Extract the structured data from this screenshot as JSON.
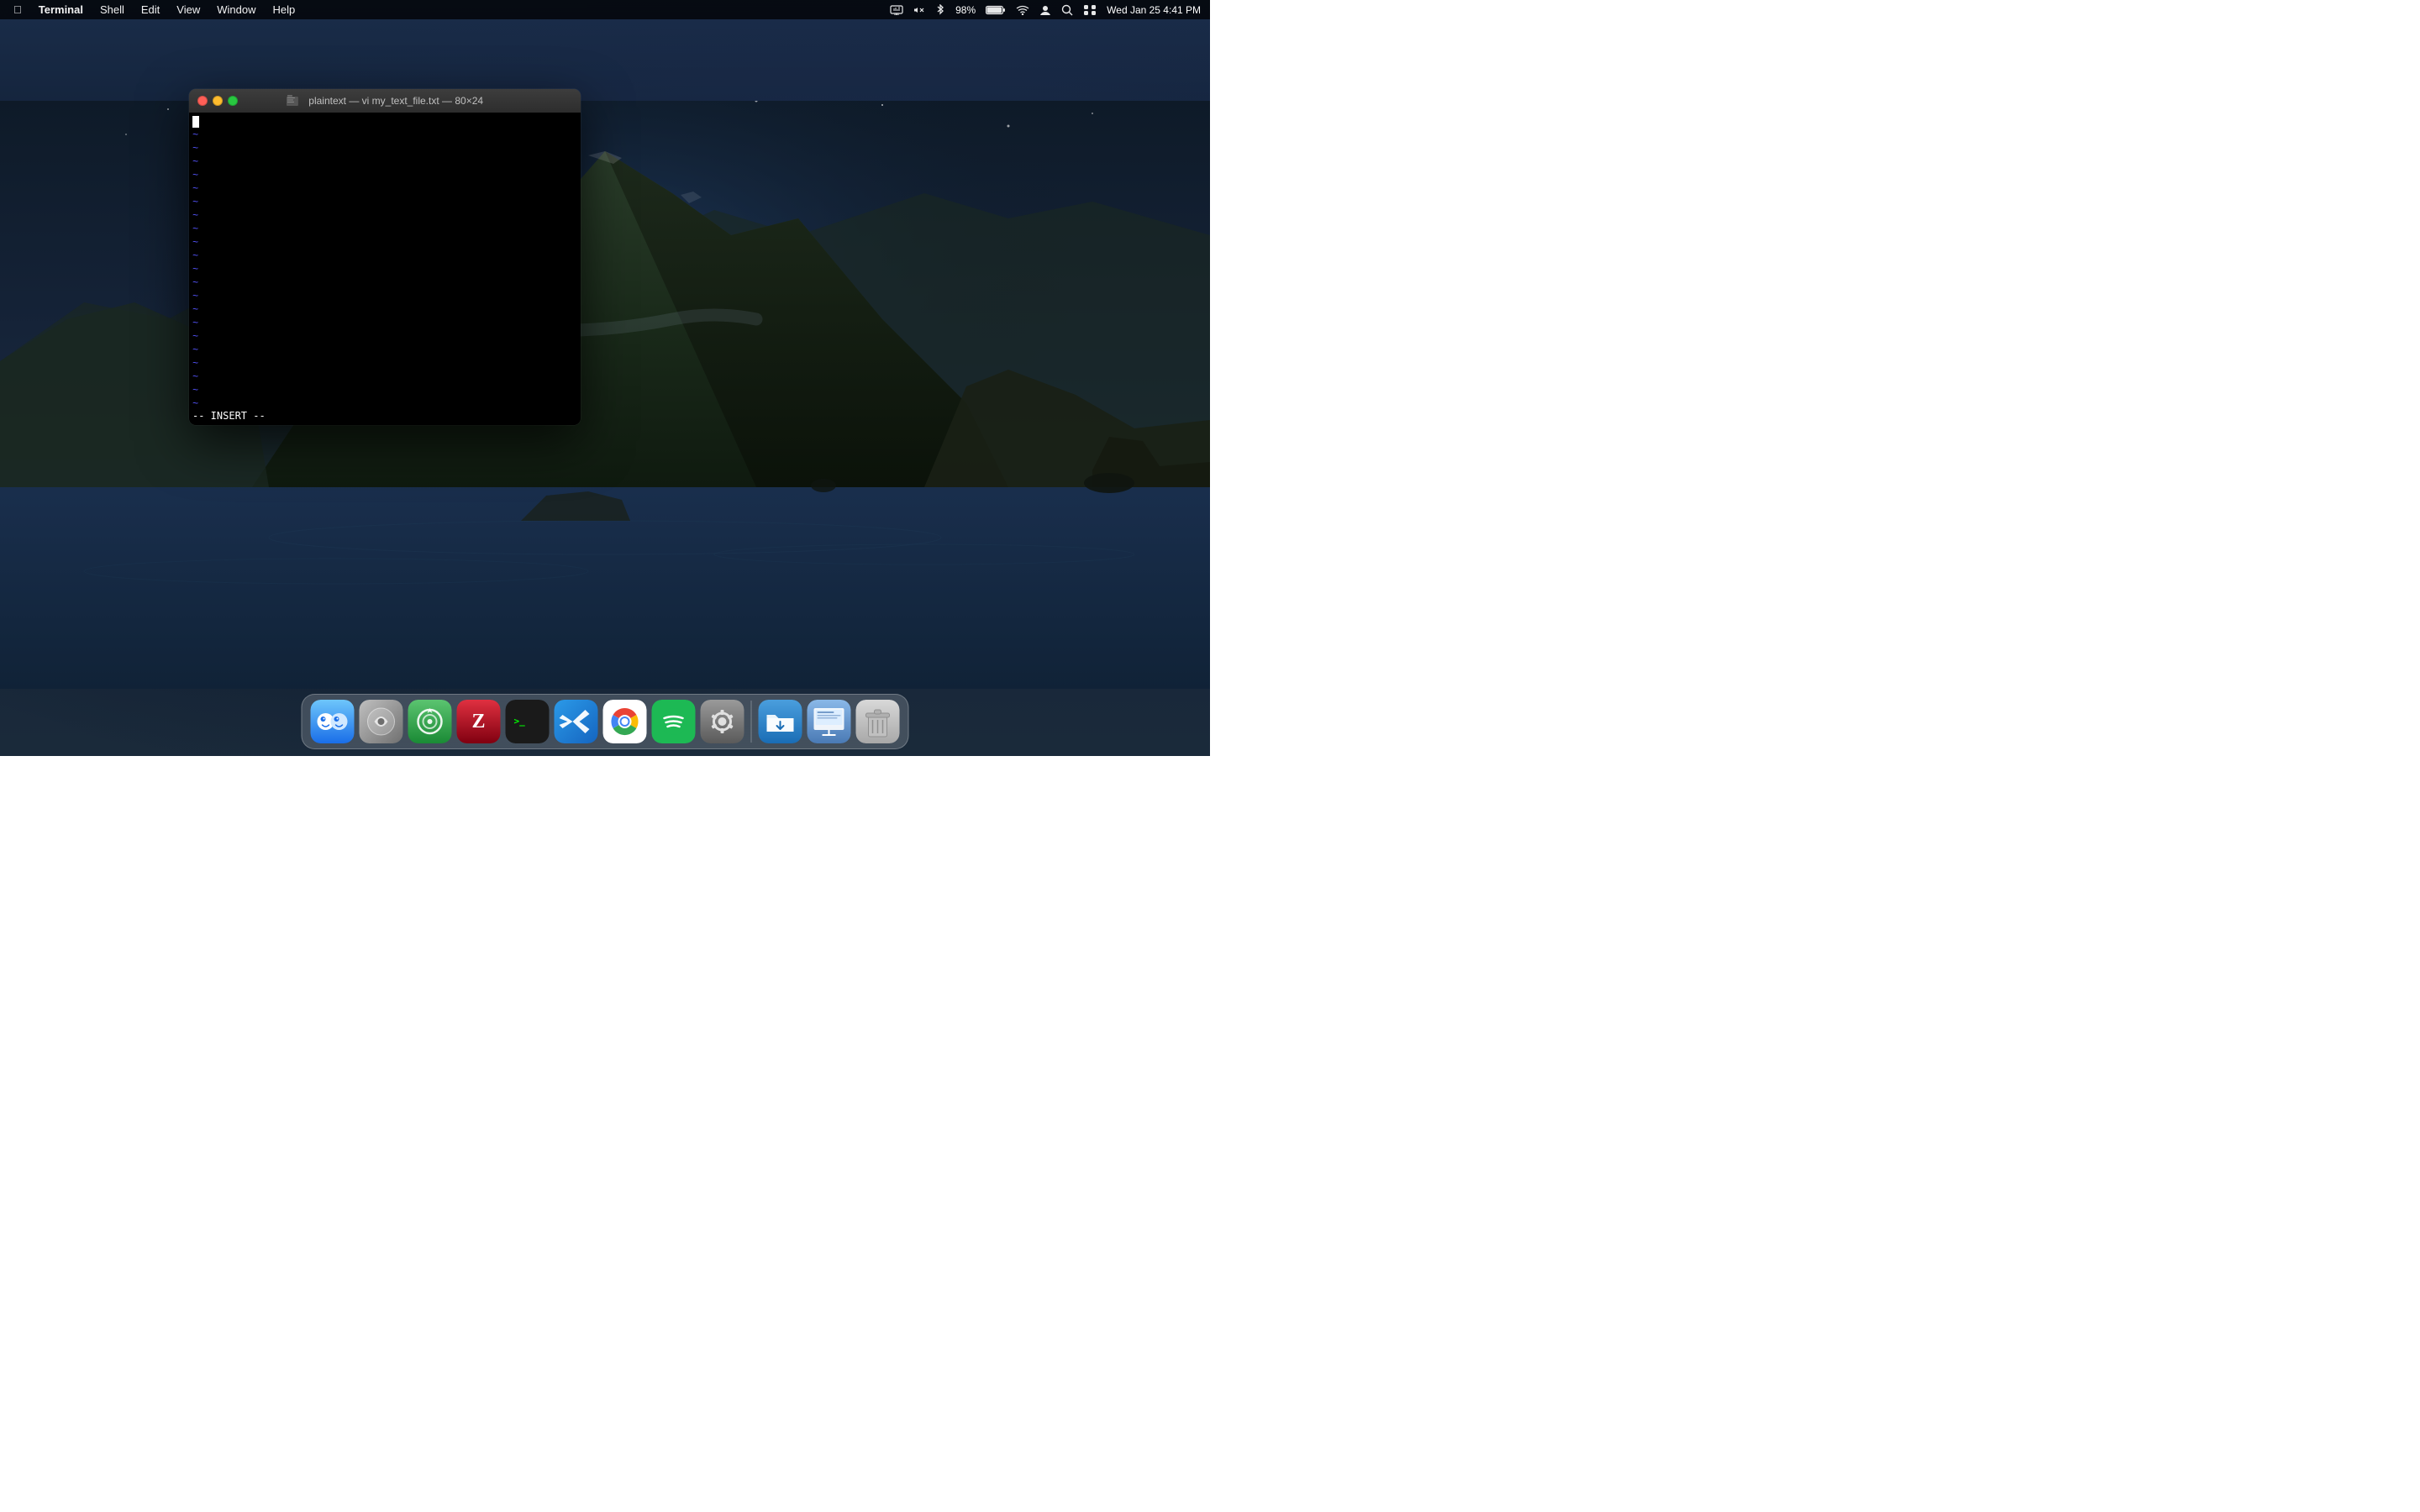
{
  "menubar": {
    "apple_label": "",
    "items": [
      {
        "label": "Terminal",
        "active": true
      },
      {
        "label": "Shell"
      },
      {
        "label": "Edit"
      },
      {
        "label": "View"
      },
      {
        "label": "Window"
      },
      {
        "label": "Help"
      }
    ],
    "right": {
      "battery_percent": "98%",
      "datetime": "Wed Jan 25  4:41 PM"
    }
  },
  "terminal": {
    "title": "plaintext — vi my_text_file.txt — 80×24",
    "insert_mode": "-- INSERT --",
    "tilde_count": 21
  },
  "dock": {
    "icons": [
      {
        "name": "finder",
        "label": "Finder"
      },
      {
        "name": "quicksilver",
        "label": "Quicksilver"
      },
      {
        "name": "proxyman",
        "label": "Proxyman"
      },
      {
        "name": "zotero",
        "label": "Zotero"
      },
      {
        "name": "terminal",
        "label": "Terminal"
      },
      {
        "name": "vscode",
        "label": "Visual Studio Code"
      },
      {
        "name": "chrome",
        "label": "Google Chrome"
      },
      {
        "name": "spotify",
        "label": "Spotify"
      },
      {
        "name": "prefs",
        "label": "System Preferences"
      },
      {
        "name": "yoink",
        "label": "Yoink"
      },
      {
        "name": "prezentation",
        "label": "Presentation"
      },
      {
        "name": "trash",
        "label": "Trash"
      }
    ]
  }
}
